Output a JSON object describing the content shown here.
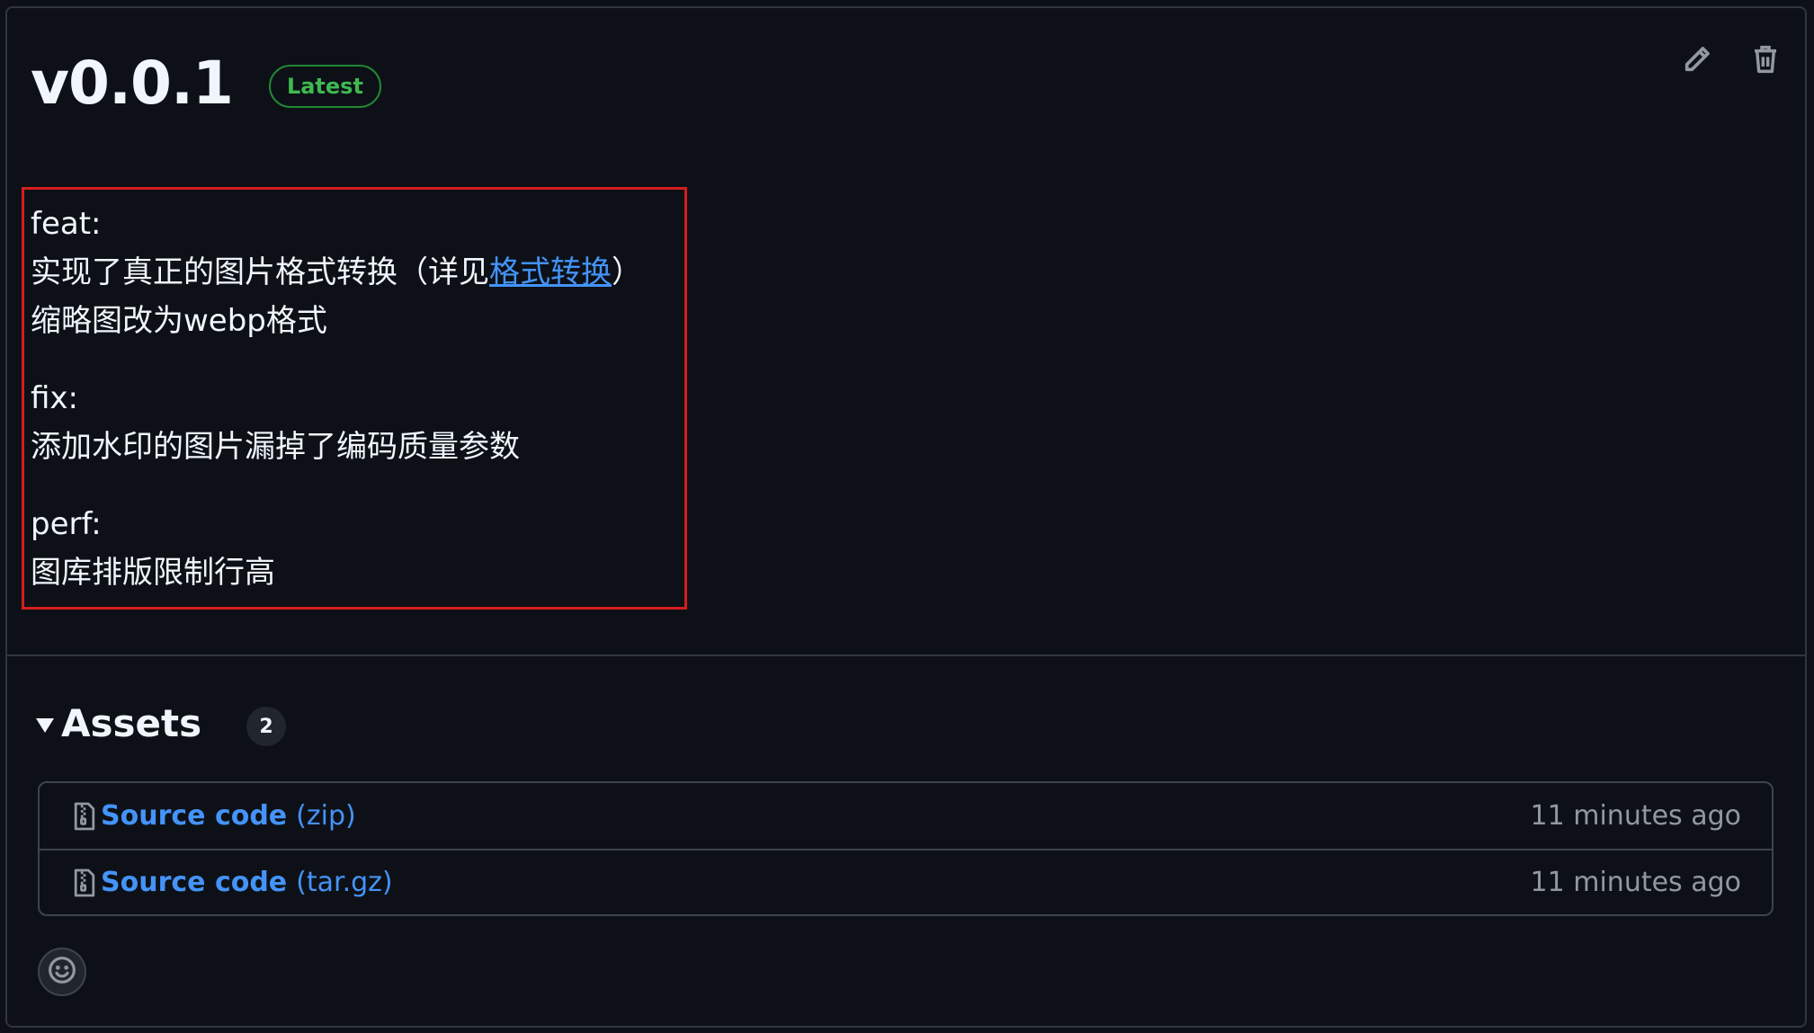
{
  "release": {
    "title": "v0.0.1",
    "badge": "Latest",
    "actions": {
      "edit_icon": "pencil-icon",
      "delete_icon": "trash-icon"
    }
  },
  "notes": {
    "feat_heading": "feat:",
    "feat_line1_prefix": "实现了真正的图片格式转换（详见",
    "feat_line1_link": "格式转换",
    "feat_line1_suffix": "）",
    "feat_line2": "缩略图改为webp格式",
    "fix_heading": "fix:",
    "fix_line1": "添加水印的图片漏掉了编码质量参数",
    "perf_heading": "perf:",
    "perf_line1": "图库排版限制行高"
  },
  "assets": {
    "title": "Assets",
    "count": "2",
    "items": [
      {
        "name": "Source code",
        "ext": "(zip)",
        "time": "11 minutes ago",
        "icon": "file-zip-icon"
      },
      {
        "name": "Source code",
        "ext": "(tar.gz)",
        "time": "11 minutes ago",
        "icon": "file-zip-icon"
      }
    ]
  },
  "reaction": {
    "icon": "smiley-icon"
  },
  "colors": {
    "background": "#0d1117",
    "border": "#30363d",
    "link": "#4493f8",
    "badge_green": "#3fb950",
    "highlight_red": "#d51d1d",
    "muted": "#9198a1"
  }
}
